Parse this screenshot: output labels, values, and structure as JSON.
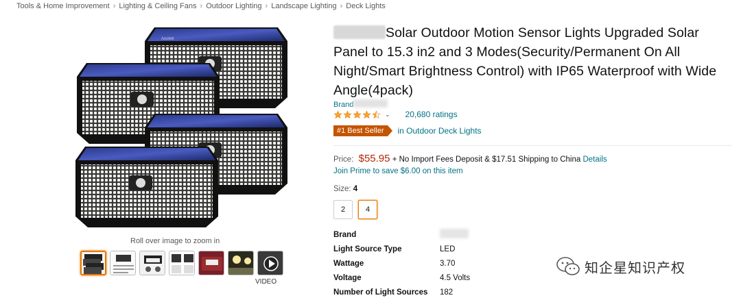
{
  "breadcrumb": [
    "Tools & Home Improvement",
    "Lighting & Ceiling Fans",
    "Outdoor Lighting",
    "Landscape Lighting",
    "Deck Lights"
  ],
  "breadcrumb_separator": "›",
  "gallery": {
    "zoom_hint": "Roll over image to zoom in",
    "video_label": "VIDEO",
    "thumbnail_count": 7,
    "product_brand_mark": "Aootek"
  },
  "product": {
    "title": "Solar Outdoor Motion Sensor Lights Upgraded Solar Panel to 15.3 in2 and 3 Modes(Security/Permanent On All Night/Smart Brightness Control) with IP65 Waterproof with Wide Angle(4pack)",
    "brand_prefix": "Brand",
    "rating_stars": 4.5,
    "ratings_text": "20,680 ratings",
    "bestseller_badge": "#1 Best Seller",
    "bestseller_category": "in Outdoor Deck Lights",
    "price_label": "Price:",
    "price": "$55.95",
    "shipping_text": "+ No Import Fees Deposit & $17.51 Shipping to China",
    "details_link": "Details",
    "prime_text": "Join Prime to save $6.00 on this item",
    "size_label": "Size:",
    "size_value": "4",
    "sizes": [
      "2",
      "4"
    ]
  },
  "specs": [
    {
      "key": "Brand",
      "value": ""
    },
    {
      "key": "Light Source Type",
      "value": "LED"
    },
    {
      "key": "Wattage",
      "value": "3.70"
    },
    {
      "key": "Voltage",
      "value": "4.5 Volts"
    },
    {
      "key": "Number of Light Sources",
      "value": "182"
    }
  ],
  "watermark": {
    "text": "知企星知识产权"
  },
  "colors": {
    "link": "#007185",
    "price": "#b12704",
    "badge": "#c45500",
    "star": "#ffa41c",
    "selected": "#e77600"
  }
}
